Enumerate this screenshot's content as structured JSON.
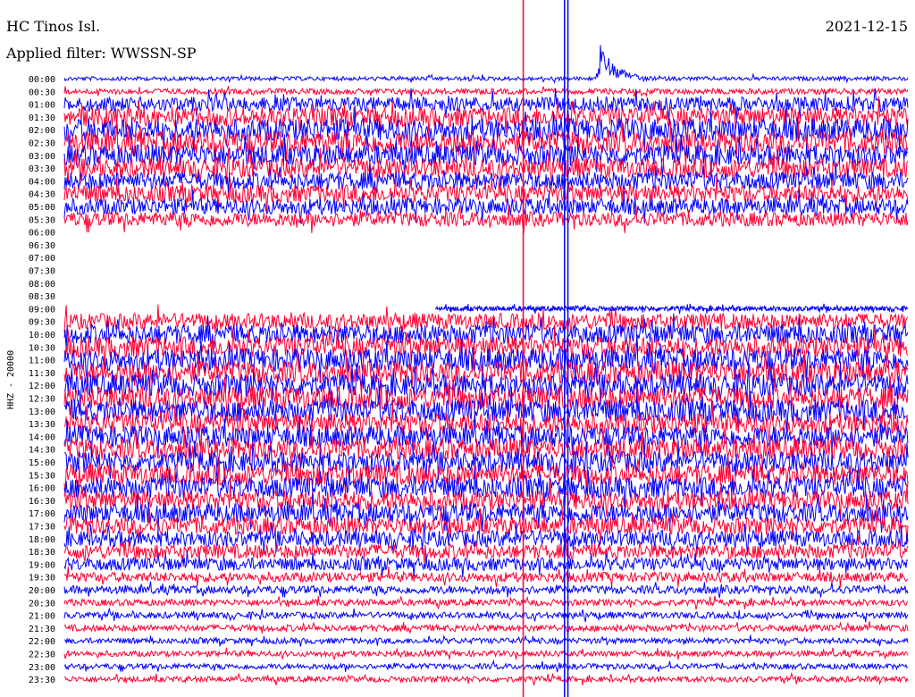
{
  "header": {
    "station": "HC Tinos Isl.",
    "filter": "Applied filter: WWSSN-SP",
    "date": "2021-12-15"
  },
  "chart_data": {
    "type": "line",
    "title": "HC Tinos Isl.",
    "subtitle": "Applied filter: WWSSN-SP",
    "date": "2021-12-15",
    "ylabel": "HHZ - 20000",
    "xlabel": "",
    "colors": {
      "even_row": "#0000ff",
      "odd_row": "#ff0033"
    },
    "rows": [
      "00:00",
      "00:30",
      "01:00",
      "01:30",
      "02:00",
      "02:30",
      "03:00",
      "03:30",
      "04:00",
      "04:30",
      "05:00",
      "05:30",
      "06:00",
      "06:30",
      "07:00",
      "07:30",
      "08:00",
      "08:30",
      "09:00",
      "09:30",
      "10:00",
      "10:30",
      "11:00",
      "11:30",
      "12:00",
      "12:30",
      "13:00",
      "13:30",
      "14:00",
      "14:30",
      "15:00",
      "15:30",
      "16:00",
      "16:30",
      "17:00",
      "17:30",
      "18:00",
      "18:30",
      "19:00",
      "19:30",
      "20:00",
      "20:30",
      "21:00",
      "21:30",
      "22:00",
      "22:30",
      "23:00",
      "23:30"
    ],
    "noise_amplitude": [
      0.25,
      0.35,
      0.9,
      1.2,
      1.4,
      1.4,
      1.3,
      1.2,
      1.1,
      1.1,
      1.0,
      0.9,
      0,
      0,
      0,
      0,
      0,
      0,
      0.3,
      1.0,
      1.2,
      1.3,
      1.4,
      1.4,
      1.4,
      1.4,
      1.4,
      1.3,
      1.3,
      1.3,
      1.3,
      1.3,
      1.3,
      1.2,
      1.2,
      1.1,
      1.0,
      0.9,
      0.8,
      0.6,
      0.5,
      0.4,
      0.4,
      0.4,
      0.35,
      0.35,
      0.35,
      0.35
    ],
    "data_gap": {
      "start": "06:00",
      "end": "08:30"
    },
    "events": [
      {
        "row": "00:00",
        "time_fraction": 0.63,
        "duration_fraction": 0.05,
        "peak_amplitude": 6
      }
    ],
    "vertical_spikes": [
      {
        "time_fraction": 0.544,
        "color": "#ff0033"
      },
      {
        "time_fraction": 0.593,
        "color": "#0000ff"
      },
      {
        "time_fraction": 0.597,
        "color": "#0000ff"
      }
    ]
  }
}
